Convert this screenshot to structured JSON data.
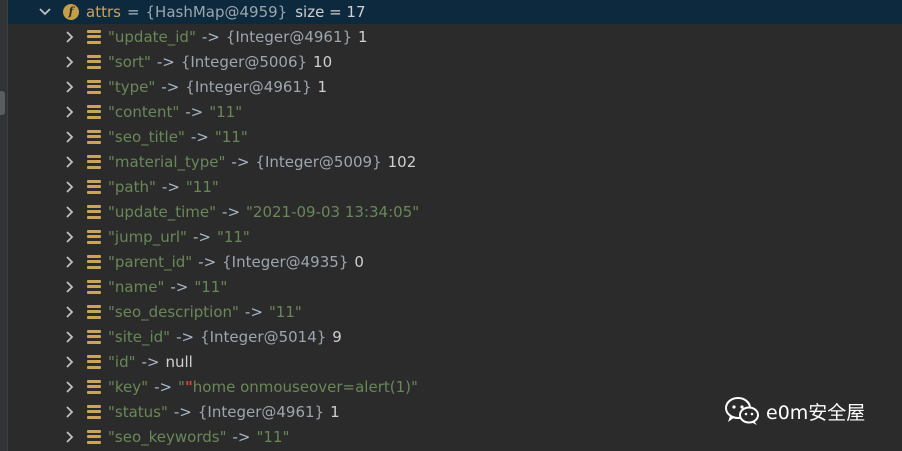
{
  "parent": {
    "name": "attrs",
    "ref": "{HashMap@4959}",
    "size_label": "size = 17",
    "field_icon_letter": "f"
  },
  "entries": [
    {
      "key": "\"update_id\"",
      "arrow": "->",
      "ref": "{Integer@4961}",
      "value": "1",
      "kind": "num"
    },
    {
      "key": "\"sort\"",
      "arrow": "->",
      "ref": "{Integer@5006}",
      "value": "10",
      "kind": "num"
    },
    {
      "key": "\"type\"",
      "arrow": "->",
      "ref": "{Integer@4961}",
      "value": "1",
      "kind": "num"
    },
    {
      "key": "\"content\"",
      "arrow": "->",
      "ref": "",
      "value": "\"11\"",
      "kind": "str"
    },
    {
      "key": "\"seo_title\"",
      "arrow": "->",
      "ref": "",
      "value": "\"11\"",
      "kind": "str"
    },
    {
      "key": "\"material_type\"",
      "arrow": "->",
      "ref": "{Integer@5009}",
      "value": "102",
      "kind": "num"
    },
    {
      "key": "\"path\"",
      "arrow": "->",
      "ref": "",
      "value": "\"11\"",
      "kind": "str"
    },
    {
      "key": "\"update_time\"",
      "arrow": "->",
      "ref": "",
      "value": "\"2021-09-03 13:34:05\"",
      "kind": "str"
    },
    {
      "key": "\"jump_url\"",
      "arrow": "->",
      "ref": "",
      "value": "\"11\"",
      "kind": "str"
    },
    {
      "key": "\"parent_id\"",
      "arrow": "->",
      "ref": "{Integer@4935}",
      "value": "0",
      "kind": "num"
    },
    {
      "key": "\"name\"",
      "arrow": "->",
      "ref": "",
      "value": "\"11\"",
      "kind": "str"
    },
    {
      "key": "\"seo_description\"",
      "arrow": "->",
      "ref": "",
      "value": "\"11\"",
      "kind": "str"
    },
    {
      "key": "\"site_id\"",
      "arrow": "->",
      "ref": "{Integer@5014}",
      "value": "9",
      "kind": "num"
    },
    {
      "key": "\"id\"",
      "arrow": "->",
      "ref": "",
      "value": "null",
      "kind": "plain"
    },
    {
      "key": "\"key\"",
      "arrow": "->",
      "ref": "",
      "value_open": "\"",
      "value_accent": "\"",
      "value_rest": "home onmouseover=alert(1)\"",
      "kind": "mixed"
    },
    {
      "key": "\"status\"",
      "arrow": "->",
      "ref": "{Integer@4961}",
      "value": "1",
      "kind": "num"
    },
    {
      "key": "\"seo_keywords\"",
      "arrow": "->",
      "ref": "",
      "value": "\"11\"",
      "kind": "str"
    }
  ],
  "watermark": {
    "text": "e0m安全屋",
    "icon": "wechat-icon"
  },
  "colors": {
    "background": "#2b2b2b",
    "selection": "#0d293e",
    "key": "#c9a45a",
    "string": "#6a8759",
    "accent_quote": "#e0443e"
  }
}
